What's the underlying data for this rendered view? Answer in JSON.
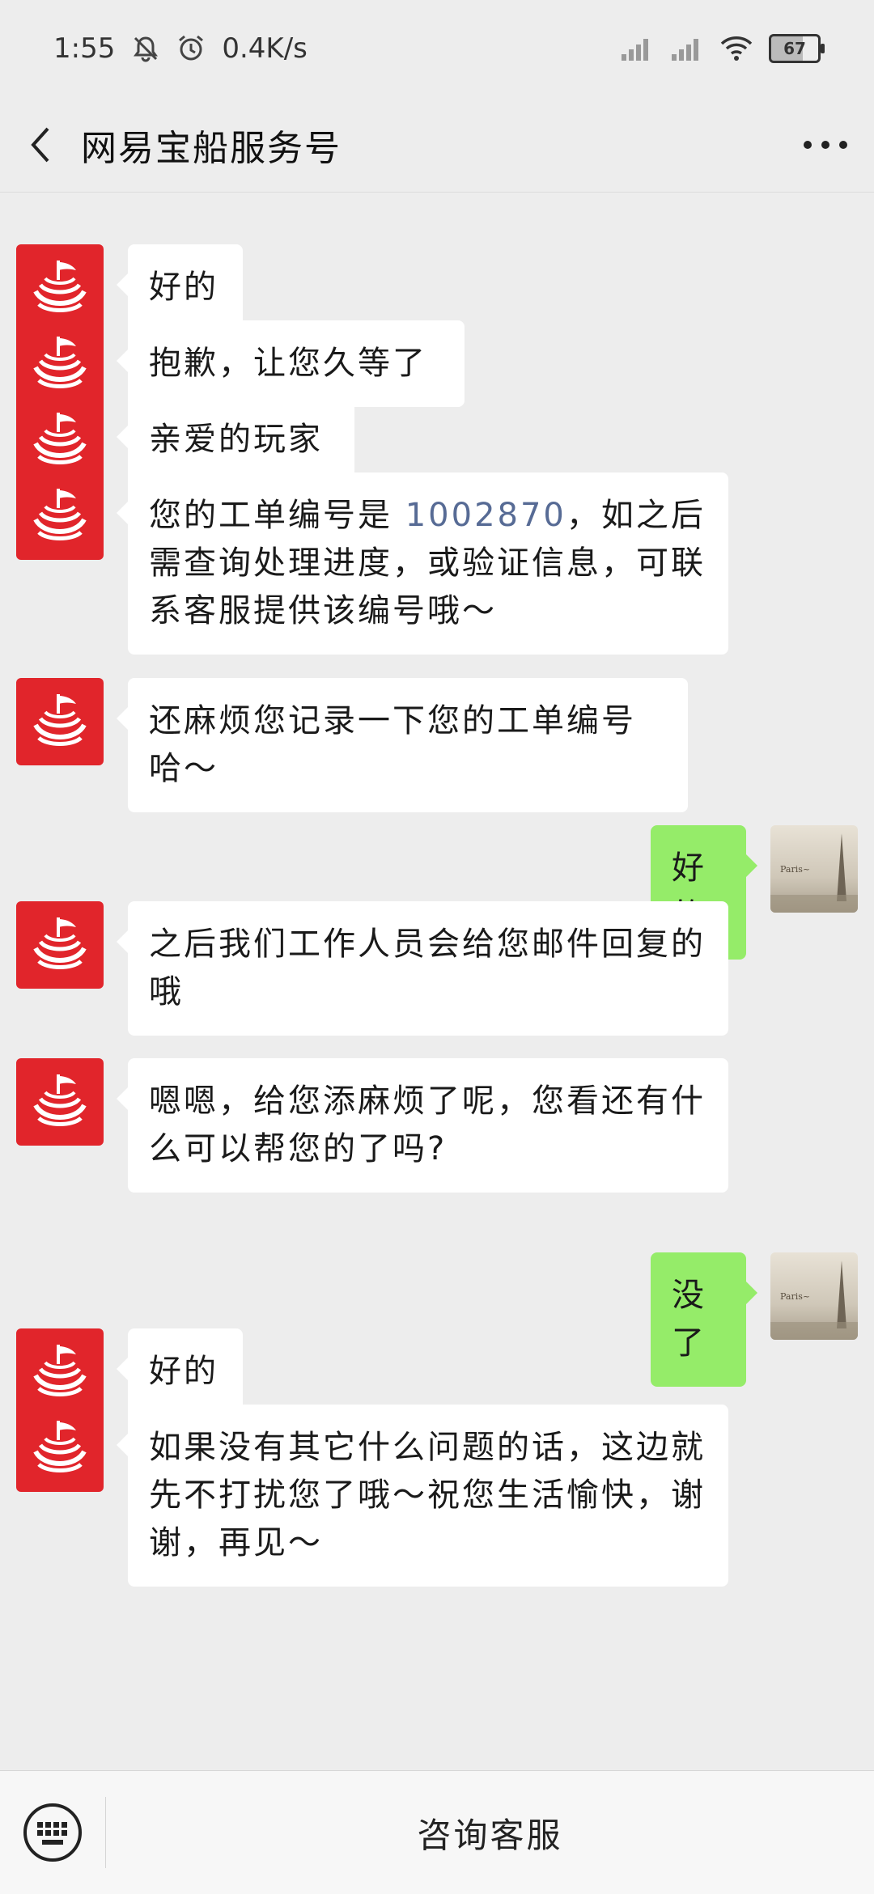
{
  "status": {
    "time": "1:55",
    "speed": "0.4K/s",
    "battery": "67"
  },
  "header": {
    "title": "网易宝船服务号"
  },
  "messages": [
    {
      "from": "bot",
      "text": "好的"
    },
    {
      "from": "bot",
      "text": "抱歉，让您久等了"
    },
    {
      "from": "bot",
      "text": "亲爱的玩家"
    },
    {
      "from": "bot",
      "pre": "您的工单编号是 ",
      "ticket": "1002870",
      "post": "，如之后需查询处理进度，或验证信息，可联系客服提供该编号哦～"
    },
    {
      "from": "bot",
      "text": "还麻烦您记录一下您的工单编号哈～"
    },
    {
      "from": "user",
      "text": "好的"
    },
    {
      "from": "bot",
      "text": "之后我们工作人员会给您邮件回复的哦"
    },
    {
      "from": "bot",
      "text": "嗯嗯，给您添麻烦了呢，您看还有什么可以帮您的了吗?"
    },
    {
      "from": "user",
      "text": "没了"
    },
    {
      "from": "bot",
      "text": "好的"
    },
    {
      "from": "bot",
      "text": "如果没有其它什么问题的话，这边就先不打扰您了哦～祝您生活愉快，谢谢，再见～"
    }
  ],
  "bottom": {
    "menu_label": "咨询客服"
  },
  "colors": {
    "accent_green": "#95ec69",
    "brand_red": "#e1252b",
    "link": "#576b95"
  }
}
